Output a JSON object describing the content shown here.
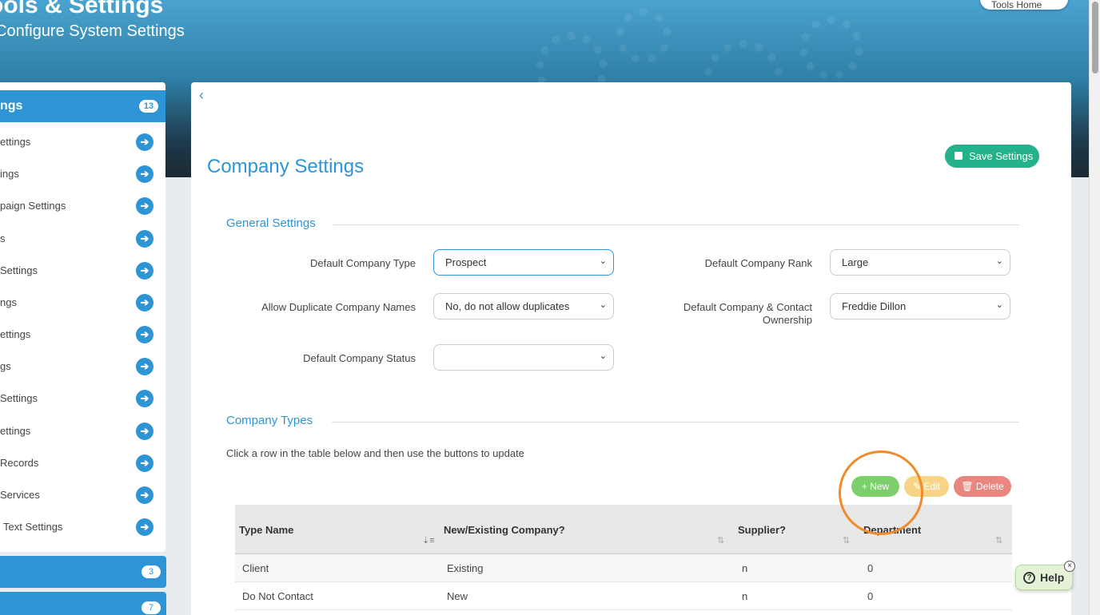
{
  "banner": {
    "title": "ools & Settings",
    "subtitle": "Configure System Settings",
    "tools_home": "Tools Home"
  },
  "sidebar": {
    "header": {
      "label": "ngs",
      "count": "13"
    },
    "items": [
      {
        "label": "ettings"
      },
      {
        "label": "ings"
      },
      {
        "label": "paign Settings"
      },
      {
        "label": "s"
      },
      {
        "label": "Settings"
      },
      {
        "label": "ngs"
      },
      {
        "label": "ettings"
      },
      {
        "label": "gs"
      },
      {
        "label": "Settings"
      },
      {
        "label": "ettings"
      },
      {
        "label": "Records"
      },
      {
        "label": "Services"
      },
      {
        "label": "Text Settings"
      }
    ],
    "section2_count": "3",
    "section3_count": "7"
  },
  "main": {
    "back": "‹",
    "title": "Company Settings",
    "save_label": "Save Settings",
    "general_title": "General Settings",
    "fields": {
      "company_type": {
        "label": "Default Company Type",
        "value": "Prospect"
      },
      "company_rank": {
        "label": "Default Company Rank",
        "value": "Large"
      },
      "duplicates": {
        "label": "Allow Duplicate Company Names",
        "value": "No, do not allow duplicates"
      },
      "ownership": {
        "label": "Default Company & Contact Ownership",
        "value": "Freddie Dillon"
      },
      "status": {
        "label": "Default Company Status",
        "value": ""
      }
    },
    "types_title": "Company Types",
    "hint": "Click a row in the table below and then use the buttons to update",
    "buttons": {
      "new": "+ New",
      "edit": "✎ Edit",
      "delete": "🗑 Delete"
    },
    "table": {
      "headers": [
        "Type Name",
        "New/Existing Company?",
        "Supplier?",
        "Department"
      ],
      "rows": [
        [
          "Client",
          "Existing",
          "n",
          "0"
        ],
        [
          "Do Not Contact",
          "New",
          "n",
          "0"
        ]
      ]
    }
  },
  "help": {
    "label": "Help",
    "close": "×"
  },
  "colors": {
    "accent": "#2d95d6",
    "save": "#25b18a",
    "new": "#7ccf6a",
    "edit": "#f7d486",
    "delete": "#e8867f",
    "ring": "#f08a2b"
  }
}
